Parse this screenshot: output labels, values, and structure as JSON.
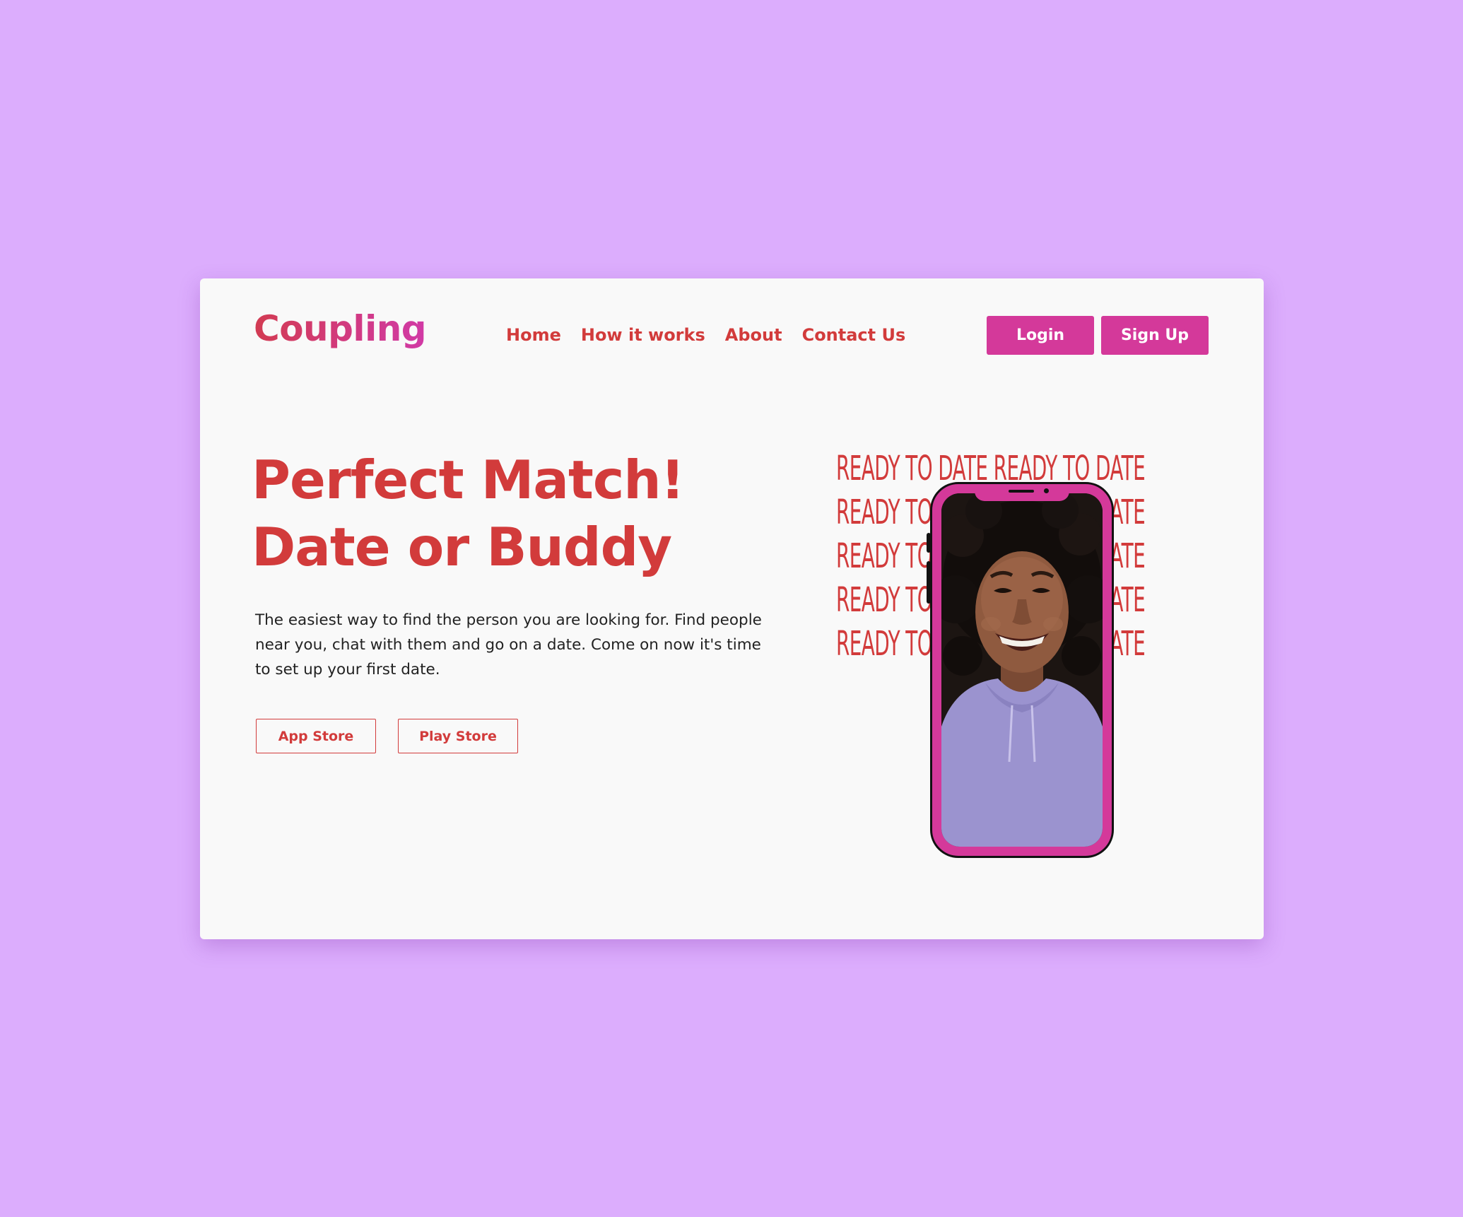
{
  "brand": {
    "logo_text": "Coupling"
  },
  "nav": {
    "items": [
      {
        "label": "Home"
      },
      {
        "label": "How it works"
      },
      {
        "label": "About"
      },
      {
        "label": "Contact Us"
      }
    ]
  },
  "auth": {
    "login_label": "Login",
    "signup_label": "Sign Up"
  },
  "hero": {
    "title_line1": "Perfect Match!",
    "title_line2": "Date or Buddy",
    "description": "The easiest way to find the person you are looking for. Find people near you, chat with them and go on a date. Come on now it's time to set up your first date.",
    "app_store_label": "App Store",
    "play_store_label": "Play Store"
  },
  "banner": {
    "lines": [
      "READY TO DATE READY TO DATE",
      "READY TO DATE READY TO DATE",
      "READY TO DATE READY TO DATE",
      "READY TO DATE READY TO DATE",
      "READY TO DATE READY TO DATE"
    ]
  },
  "phone": {
    "image": "smiling-woman-portrait"
  },
  "colors": {
    "page_background": "#dcadfd",
    "card_background": "#f9f9f9",
    "accent_red": "#d23b3b",
    "accent_pink": "#d4399a"
  }
}
